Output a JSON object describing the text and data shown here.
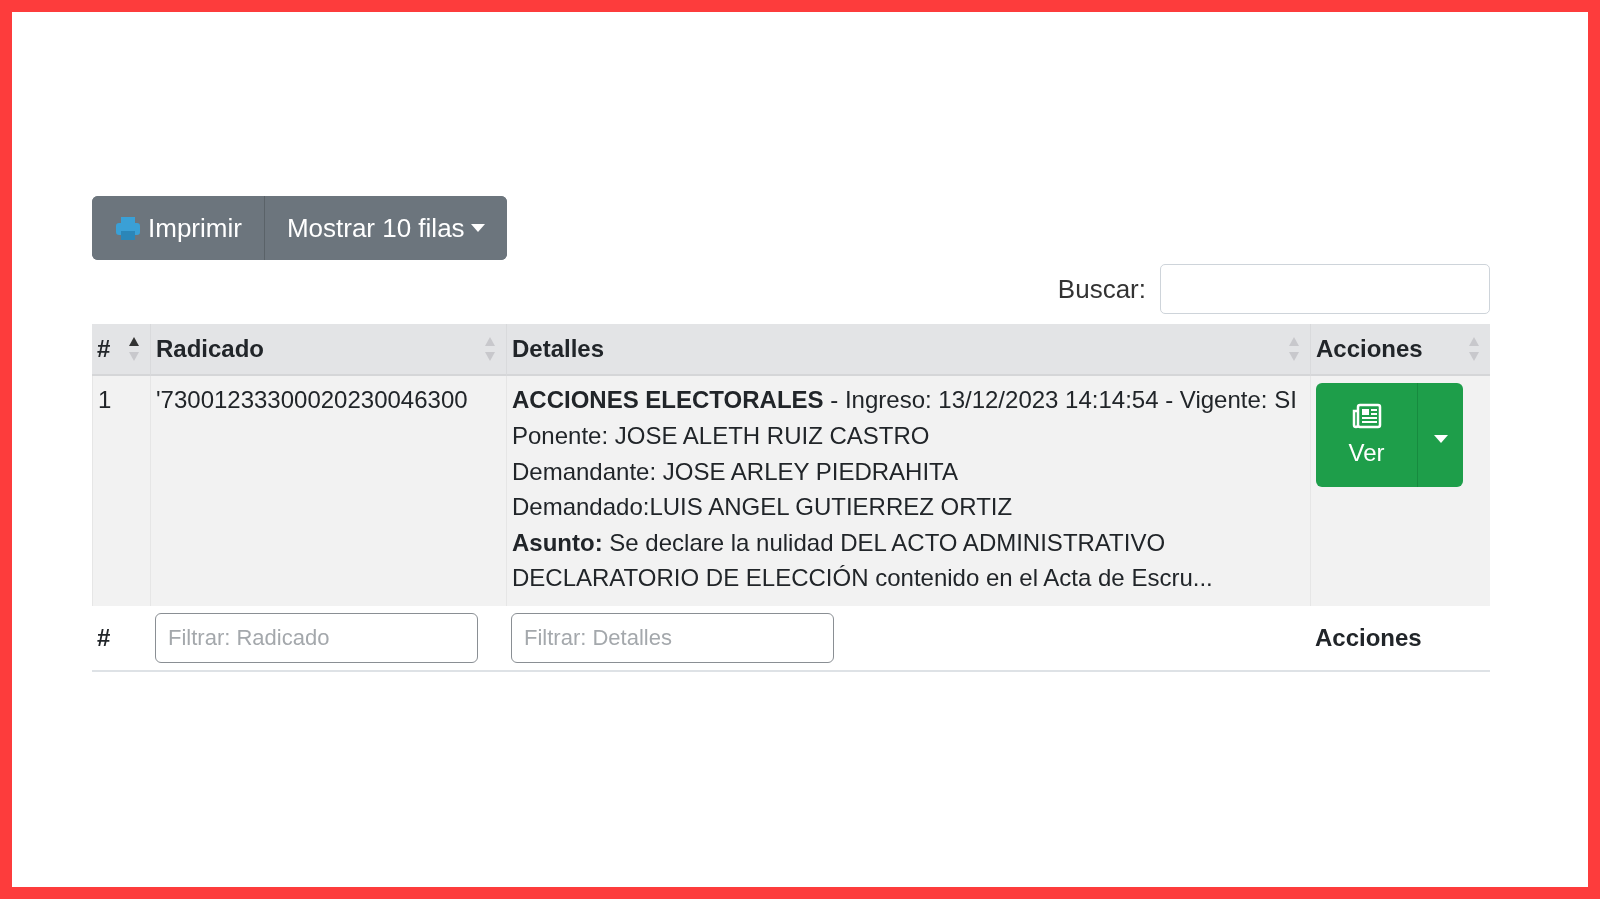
{
  "toolbar": {
    "buttons": [
      {
        "kind": "print",
        "label": "Imprimir"
      },
      {
        "kind": "dropdown",
        "label": "Mostrar 10 filas"
      }
    ]
  },
  "search": {
    "label": "Buscar:"
  },
  "table": {
    "columns": [
      {
        "label": "#",
        "sorted": true
      },
      {
        "label": "Radicado",
        "sorted": false
      },
      {
        "label": "Detalles",
        "sorted": false
      },
      {
        "label": "Acciones",
        "sorted": false
      }
    ],
    "rows": [
      {
        "number": "1",
        "radicado": "'73001233300020230046300",
        "details": [
          "**ACCIONES ELECTORALES** - Ingreso: 13/12/2023 14:14:54 - Vigente: SI",
          "Ponente: JOSE ALETH RUIZ CASTRO",
          "Demandante: JOSE ARLEY PIEDRAHITA",
          "Demandado:LUIS ANGEL GUTIERREZ ORTIZ",
          "**Asunto:** Se declare la nulidad DEL ACTO ADMINISTRATIVO",
          "DECLARATORIO DE ELECCIÓN contenido en el Acta de Escru..."
        ],
        "action": "Ver"
      }
    ],
    "footer": [
      {
        "kind": "text",
        "label": "#"
      },
      {
        "kind": "filter",
        "placeholder": "Filtrar: Radicado"
      },
      {
        "kind": "filter",
        "placeholder": "Filtrar: Detalles"
      },
      {
        "kind": "text",
        "label": "Acciones"
      }
    ]
  }
}
